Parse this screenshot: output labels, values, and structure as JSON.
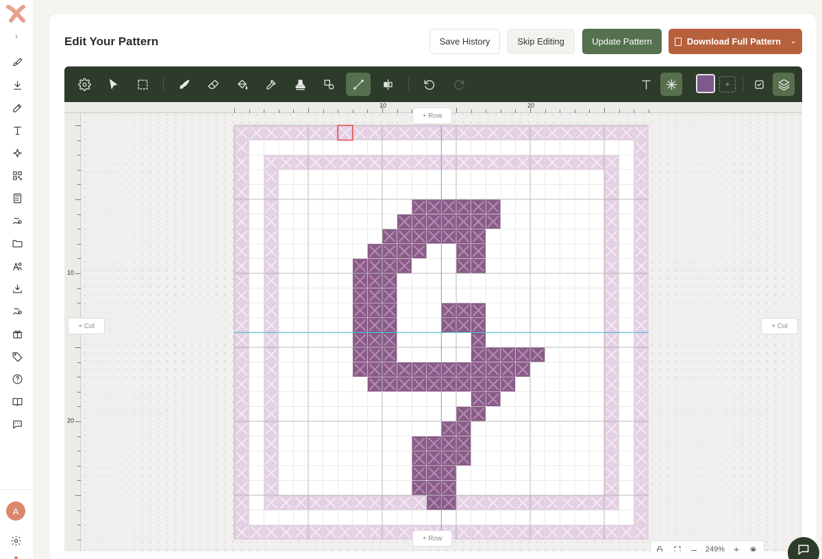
{
  "header": {
    "title": "Edit Your Pattern",
    "save_history": "Save History",
    "skip_editing": "Skip Editing",
    "update_pattern": "Update Pattern",
    "download_full_pattern": "Download Full Pattern"
  },
  "sidebar": {
    "avatar_initial": "A",
    "items": [
      "brush-icon",
      "download-icon",
      "edit-icon",
      "text-icon",
      "sparkle-icon",
      "qr-icon",
      "calculator-icon",
      "thread-icon",
      "folder-icon",
      "users-icon",
      "download-tray-icon",
      "thread-alt-icon",
      "gift-icon",
      "tag-icon",
      "help-icon",
      "book-icon",
      "chat-icon"
    ]
  },
  "toolbar": {
    "tools": [
      "settings",
      "select",
      "marquee",
      "paint-brush",
      "eraser",
      "fill-bucket",
      "eyedropper",
      "stamp",
      "shapes",
      "line",
      "mirror",
      "undo",
      "redo",
      "text",
      "snowflake",
      "color-swatch",
      "add-color",
      "checkbox",
      "layers"
    ],
    "active_tools": [
      "line",
      "snowflake",
      "layers"
    ],
    "current_color": "#7e5a8c",
    "add_color_label": "+"
  },
  "canvas": {
    "ruler_top_labels": [
      "10",
      "20"
    ],
    "ruler_left_labels": [
      "10",
      "20"
    ],
    "add_row_label": "+ Row",
    "add_col_label": "+ Col",
    "zoom_level": "249%",
    "grid_cols": 28,
    "grid_rows": 28,
    "border_color": "#e4cfe3",
    "stitch_color": "#8a5b88",
    "selection_color": "#e0474b"
  }
}
